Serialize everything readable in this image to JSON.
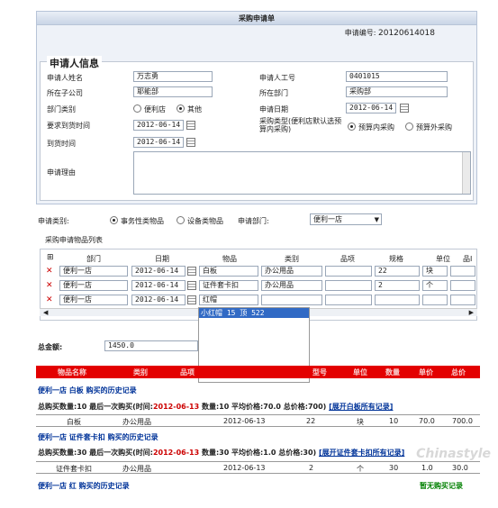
{
  "form": {
    "title": "采购申请单",
    "app_no_label": "申请编号:",
    "app_no": "20120614018",
    "section": "申请人信息",
    "name_label": "申请人姓名",
    "name": "万志勇",
    "empno_label": "申请人工号",
    "empno": "0401015",
    "company_label": "所在子公司",
    "company": "耶能部",
    "dept_label": "所在部门",
    "dept": "采购部",
    "depttype_label": "部门类别",
    "depttype_opt1": "便利店",
    "depttype_opt2": "其他",
    "appdate_label": "申请日期",
    "appdate": "2012-06-14",
    "reqdate_label": "要求到货时间",
    "reqdate": "2012-06-14",
    "purtype_label": "采购类型(便利店默认选预算内采购)",
    "purtype_opt1": "预算内采购",
    "purtype_opt2": "预算外采购",
    "arrdate_label": "到货时间",
    "arrdate": "2012-06-14",
    "reason_label": "申请理由"
  },
  "filter": {
    "type_label": "申请类别:",
    "type_opt1": "事务性类物品",
    "type_opt2": "设备类物品",
    "dept_label": "申请部门:",
    "dept_value": "便利一店"
  },
  "items": {
    "legend": "采购申请物品列表",
    "headers": [
      "部门",
      "日期",
      "物品",
      "类别",
      "品项",
      "规格",
      "单位",
      "品I"
    ],
    "rows": [
      {
        "dept": "便利一店",
        "date": "2012-06-14",
        "item": "白板",
        "cat": "办公用品",
        "spec": "22",
        "unit": "块"
      },
      {
        "dept": "便利一店",
        "date": "2012-06-14",
        "item": "证件套卡扣",
        "cat": "办公用品",
        "spec": "2",
        "unit": "个"
      },
      {
        "dept": "便利一店",
        "date": "2012-06-14",
        "item": "红帽",
        "cat": "",
        "spec": "",
        "unit": ""
      }
    ],
    "suggest": "小红帽 15 顶 522"
  },
  "total": {
    "label": "总金额:",
    "value": "1450.0"
  },
  "history": {
    "headers": [
      "物品名称",
      "类别",
      "品项",
      "",
      "",
      "",
      "型号",
      "单位",
      "数量",
      "单价",
      "总价"
    ],
    "blocks": [
      {
        "title": "便利一店 白板 购买的历史记录",
        "summary_a": "总购买数量:10 最后一次购买(时间:",
        "summary_date": "2012-06-13",
        "summary_b": " 数量:10 平均价格:70.0 总价格:700)",
        "link": "[展开白板所有记录]",
        "row": [
          "白板",
          "办公用品",
          "2012-06-13",
          "22",
          "块",
          "10",
          "70.0",
          "700.0"
        ]
      },
      {
        "title": "便利一店 证件套卡扣 购买的历史记录",
        "summary_a": "总购买数量:30 最后一次购买(时间:",
        "summary_date": "2012-06-13",
        "summary_b": " 数量:30 平均价格:1.0 总价格:30)",
        "link": "[展开证件套卡扣所有记录]",
        "row": [
          "证件套卡扣",
          "办公用品",
          "2012-06-13",
          "2",
          "个",
          "30",
          "1.0",
          "30.0"
        ]
      },
      {
        "title": "便利一店 红 购买的历史记录",
        "none": "暂无购买记录"
      }
    ]
  },
  "watermark": "Chinastyle"
}
